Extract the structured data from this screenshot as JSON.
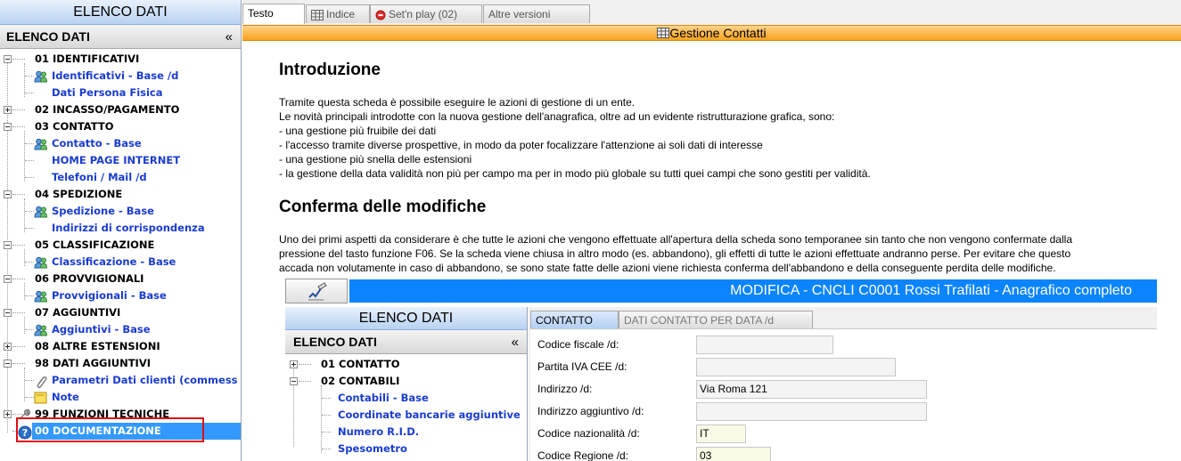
{
  "left_panel": {
    "header": "ELENCO DATI",
    "subheader": "ELENCO DATI",
    "collapse_glyph": "«",
    "tree": [
      {
        "label": "01 IDENTIFICATIVI",
        "level": 0,
        "expander": "minus"
      },
      {
        "label": "Identificativi - Base /d",
        "level": 1,
        "icon": "users-icon"
      },
      {
        "label": "Dati Persona Fisica",
        "level": 1
      },
      {
        "label": "02 INCASSO/PAGAMENTO",
        "level": 0,
        "expander": "plus"
      },
      {
        "label": "03 CONTATTO",
        "level": 0,
        "expander": "minus"
      },
      {
        "label": "Contatto - Base",
        "level": 1,
        "icon": "users-icon"
      },
      {
        "label": "HOME PAGE INTERNET",
        "level": 1
      },
      {
        "label": "Telefoni / Mail /d",
        "level": 1
      },
      {
        "label": "04 SPEDIZIONE",
        "level": 0,
        "expander": "minus"
      },
      {
        "label": "Spedizione - Base",
        "level": 1,
        "icon": "users-icon"
      },
      {
        "label": "Indirizzi di corrispondenza",
        "level": 1
      },
      {
        "label": "05 CLASSIFICAZIONE",
        "level": 0,
        "expander": "minus"
      },
      {
        "label": "Classificazione - Base",
        "level": 1,
        "icon": "users-icon"
      },
      {
        "label": "06 PROVVIGIONALI",
        "level": 0,
        "expander": "minus"
      },
      {
        "label": "Provvigionali - Base",
        "level": 1,
        "icon": "users-icon"
      },
      {
        "label": "07 AGGIUNTIVI",
        "level": 0,
        "expander": "minus"
      },
      {
        "label": "Aggiuntivi - Base",
        "level": 1,
        "icon": "users-icon"
      },
      {
        "label": "08 ALTRE ESTENSIONI",
        "level": 0,
        "expander": "plus"
      },
      {
        "label": "98 DATI AGGIUNTIVI",
        "level": 0,
        "expander": "minus"
      },
      {
        "label": "Parametri Dati clienti (commess",
        "level": 1,
        "icon": "paperclip-icon"
      },
      {
        "label": "Note",
        "level": 1,
        "icon": "note-icon"
      },
      {
        "label": "99 FUNZIONI TECNICHE",
        "level": 0,
        "expander": "plus",
        "icon": "wrench-icon"
      },
      {
        "label": "00 DOCUMENTAZIONE",
        "level": 0,
        "icon": "help-icon",
        "selected": true
      }
    ]
  },
  "tabs": [
    {
      "label": "Testo",
      "active": true
    },
    {
      "label": "Indice",
      "icon": "grid-icon"
    },
    {
      "label": "Set'n play (02)",
      "icon": "record-icon"
    },
    {
      "label": "Altre versioni"
    }
  ],
  "section_title": "Gestione Contatti",
  "document": {
    "heading1": "Introduzione",
    "intro_lines": [
      "Tramite questa scheda è possibile eseguire le azioni di gestione di un ente.",
      "Le novità principali introdotte con la nuova gestione dell'anagrafica, oltre ad un evidente ristrutturazione grafica, sono:",
      "- una gestione più fruibile dei dati",
      "- l'accesso tramite diverse prospettive, in modo da poter focalizzare l'attenzione ai soli dati di interesse",
      "- una gestione più snella delle estensioni",
      "- la gestione della data validità non più per campo ma per in modo più globale su tutti quei campi che sono gestiti per validità."
    ],
    "heading2": "Conferma delle modifiche",
    "confirm_lines": [
      "Uno dei primi aspetti da considerare è che tutte le azioni che vengono effettuate all'apertura della scheda sono temporanee sin tanto che non vengono confermate dalla",
      "pressione del tasto funzione F06. Se la scheda viene chiusa in altro modo (es. abbandono), gli effetti di tutte le azioni effettuate andranno perse. Per evitare che questo",
      "accada non volutamente in caso di abbandono, se sono state fatte delle azioni viene richiesta conferma dell'abbandono e della conseguente perdita delle modifiche."
    ]
  },
  "embedded": {
    "title": "MODIFICA - CNCLI C0001 Rossi Trafilati - Anagrafico completo",
    "left_header": "ELENCO DATI",
    "left_subheader": "ELENCO DATI",
    "collapse_glyph": "«",
    "tree": [
      {
        "label": "01 CONTATTO",
        "level": 0,
        "expander": "plus"
      },
      {
        "label": "02 CONTABILI",
        "level": 0,
        "expander": "minus"
      },
      {
        "label": "Contabili - Base",
        "level": 1
      },
      {
        "label": "Coordinate bancarie aggiuntive",
        "level": 1
      },
      {
        "label": "Numero R.I.D.",
        "level": 1
      },
      {
        "label": "Spesometro",
        "level": 1
      }
    ],
    "tabs": [
      {
        "label": "CONTATTO",
        "active": true
      },
      {
        "label": "DATI CONTATTO PER DATA /d"
      }
    ],
    "fields": [
      {
        "label": "Codice fiscale /d:",
        "value": ""
      },
      {
        "label": "Partita IVA CEE /d:",
        "value": ""
      },
      {
        "label": "Indirizzo /d:",
        "value": "Via Roma 121"
      },
      {
        "label": "Indirizzo aggiuntivo /d:",
        "value": ""
      },
      {
        "label": "Codice nazionalità /d:",
        "value": "IT"
      },
      {
        "label": "Codice Regione /d:",
        "value": "03"
      }
    ]
  },
  "colors": {
    "header_blue": "#b8d2f2",
    "link_blue": "#1a3ccf",
    "selection": "#3399ff",
    "orange_bar": "#f7a21b",
    "title_blue": "#0a84ff",
    "highlight_red": "#e01010"
  }
}
